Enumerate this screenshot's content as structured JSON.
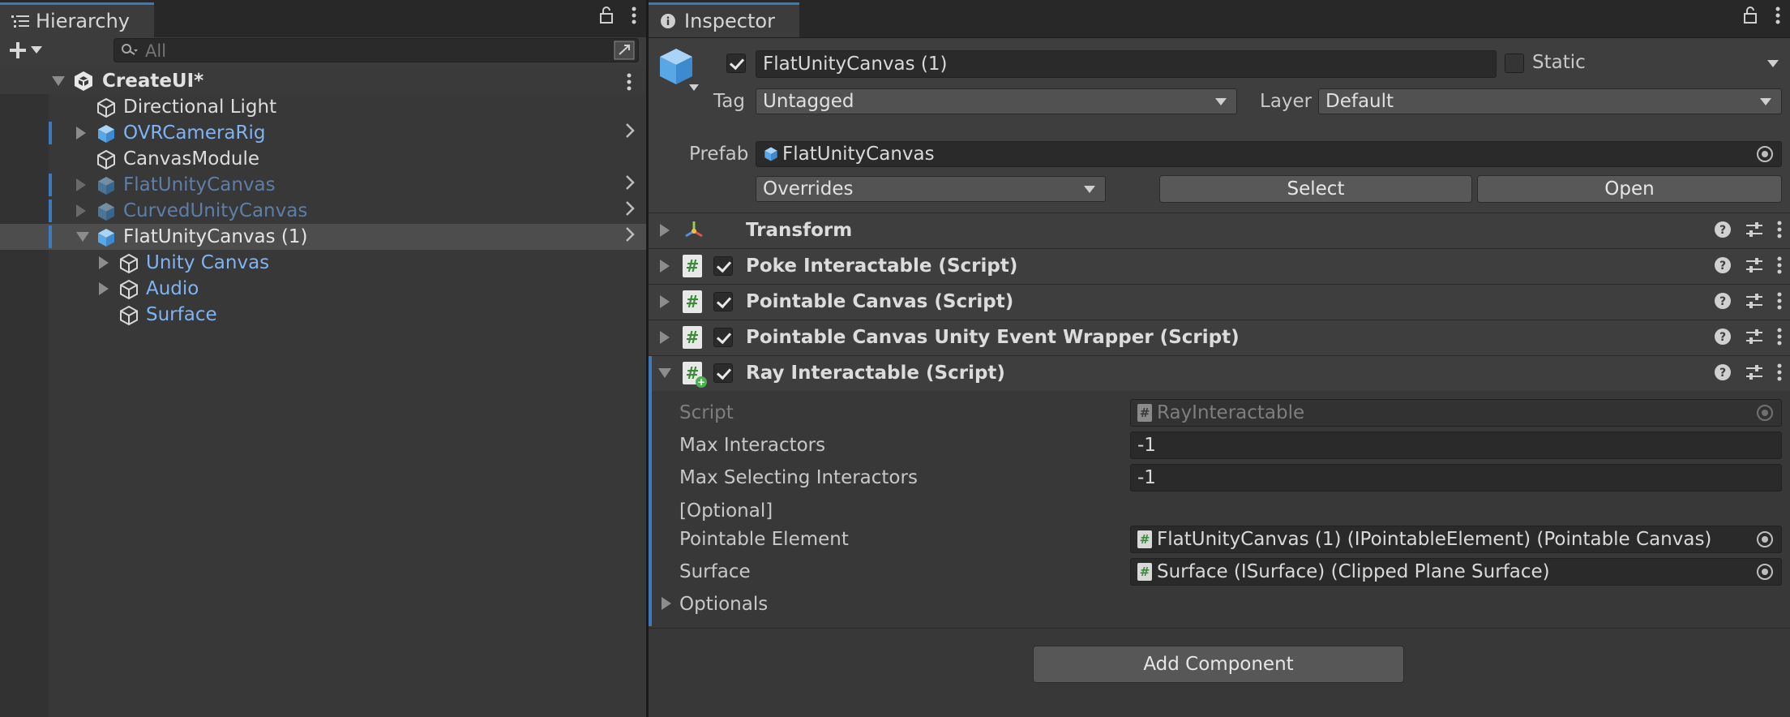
{
  "hierarchy": {
    "tab_title": "Hierarchy",
    "search_placeholder": "All",
    "scene_name": "CreateUI*",
    "items": [
      {
        "label": "Directional Light"
      },
      {
        "label": "OVRCameraRig"
      },
      {
        "label": "CanvasModule"
      },
      {
        "label": "FlatUnityCanvas"
      },
      {
        "label": "CurvedUnityCanvas"
      },
      {
        "label": "FlatUnityCanvas (1)"
      },
      {
        "label": "Unity Canvas"
      },
      {
        "label": "Audio"
      },
      {
        "label": "Surface"
      }
    ]
  },
  "inspector": {
    "tab_title": "Inspector",
    "object_name": "FlatUnityCanvas (1)",
    "static_label": "Static",
    "tag_label": "Tag",
    "tag_value": "Untagged",
    "layer_label": "Layer",
    "layer_value": "Default",
    "prefab_label": "Prefab",
    "prefab_value": "FlatUnityCanvas",
    "overrides_value": "Overrides",
    "select_label": "Select",
    "open_label": "Open",
    "components": [
      {
        "title": "Transform"
      },
      {
        "title": "Poke Interactable (Script)"
      },
      {
        "title": "Pointable Canvas (Script)"
      },
      {
        "title": "Pointable Canvas Unity Event Wrapper (Script)"
      },
      {
        "title": "Ray Interactable (Script)"
      }
    ],
    "ray": {
      "script_label": "Script",
      "script_value": "RayInteractable",
      "max_interactors_label": "Max Interactors",
      "max_interactors_value": "-1",
      "max_selecting_label": "Max Selecting Interactors",
      "max_selecting_value": "-1",
      "optional_header": "[Optional]",
      "pointable_label": "Pointable Element",
      "pointable_value": "FlatUnityCanvas (1) (IPointableElement) (Pointable Canvas)",
      "surface_label": "Surface",
      "surface_value": "Surface (ISurface) (Clipped Plane Surface)",
      "optionals_label": "Optionals"
    },
    "add_component_label": "Add Component"
  },
  "colors": {
    "accent": "#3a79bb",
    "prefab_blue": "#7fb3f2",
    "panel": "#383838"
  }
}
